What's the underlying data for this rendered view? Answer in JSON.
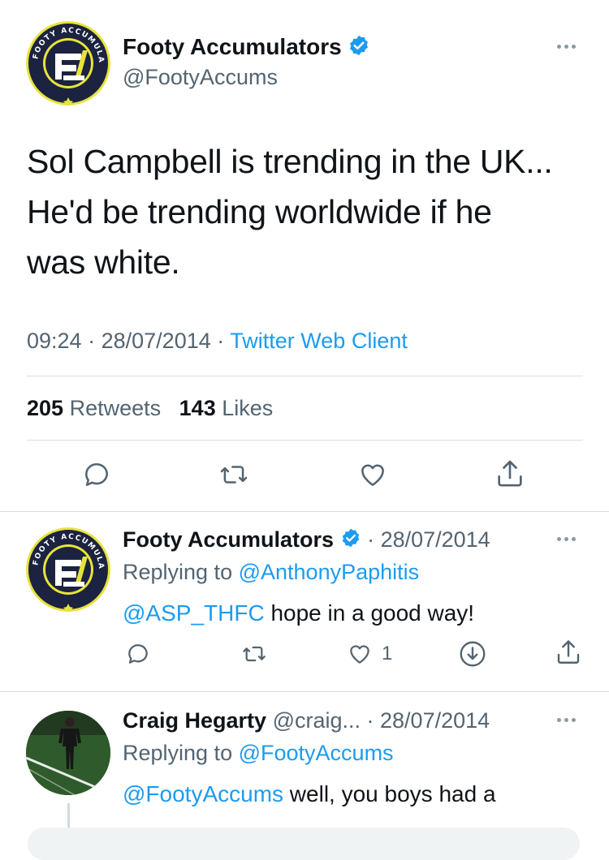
{
  "main_tweet": {
    "author_name": "Footy Accumulators",
    "handle": "@FootyAccums",
    "avatar_logo_text": "FOOTY ACCUMULATORS",
    "lines": [
      "Sol Campbell is trending in the UK...",
      "He'd be trending worldwide if he",
      "was white."
    ],
    "time": "09:24",
    "date": "28/07/2014",
    "separator": "·",
    "client": "Twitter Web Client",
    "retweets_count": "205",
    "retweets_label": "Retweets",
    "likes_count": "143",
    "likes_label": "Likes"
  },
  "replies": [
    {
      "author_name": "Footy Accumulators",
      "handle": "",
      "date": "· 28/07/2014",
      "replying_prefix": "Replying to",
      "replying_to": "@AnthonyPaphitis",
      "mention": "@ASP_THFC",
      "text": " hope in a good way!",
      "like_count": "1"
    },
    {
      "author_name": "Craig Hegarty",
      "handle": "@craig...",
      "date": "· 28/07/2014",
      "replying_prefix": "Replying to",
      "replying_to": "@FootyAccums",
      "mention": "@FootyAccums",
      "text": " well, you boys had a"
    }
  ],
  "colors": {
    "accent": "#1d9bf0",
    "secondary_text": "#536471",
    "logo_navy": "#1b2340",
    "logo_yellow": "#e8e33a"
  }
}
